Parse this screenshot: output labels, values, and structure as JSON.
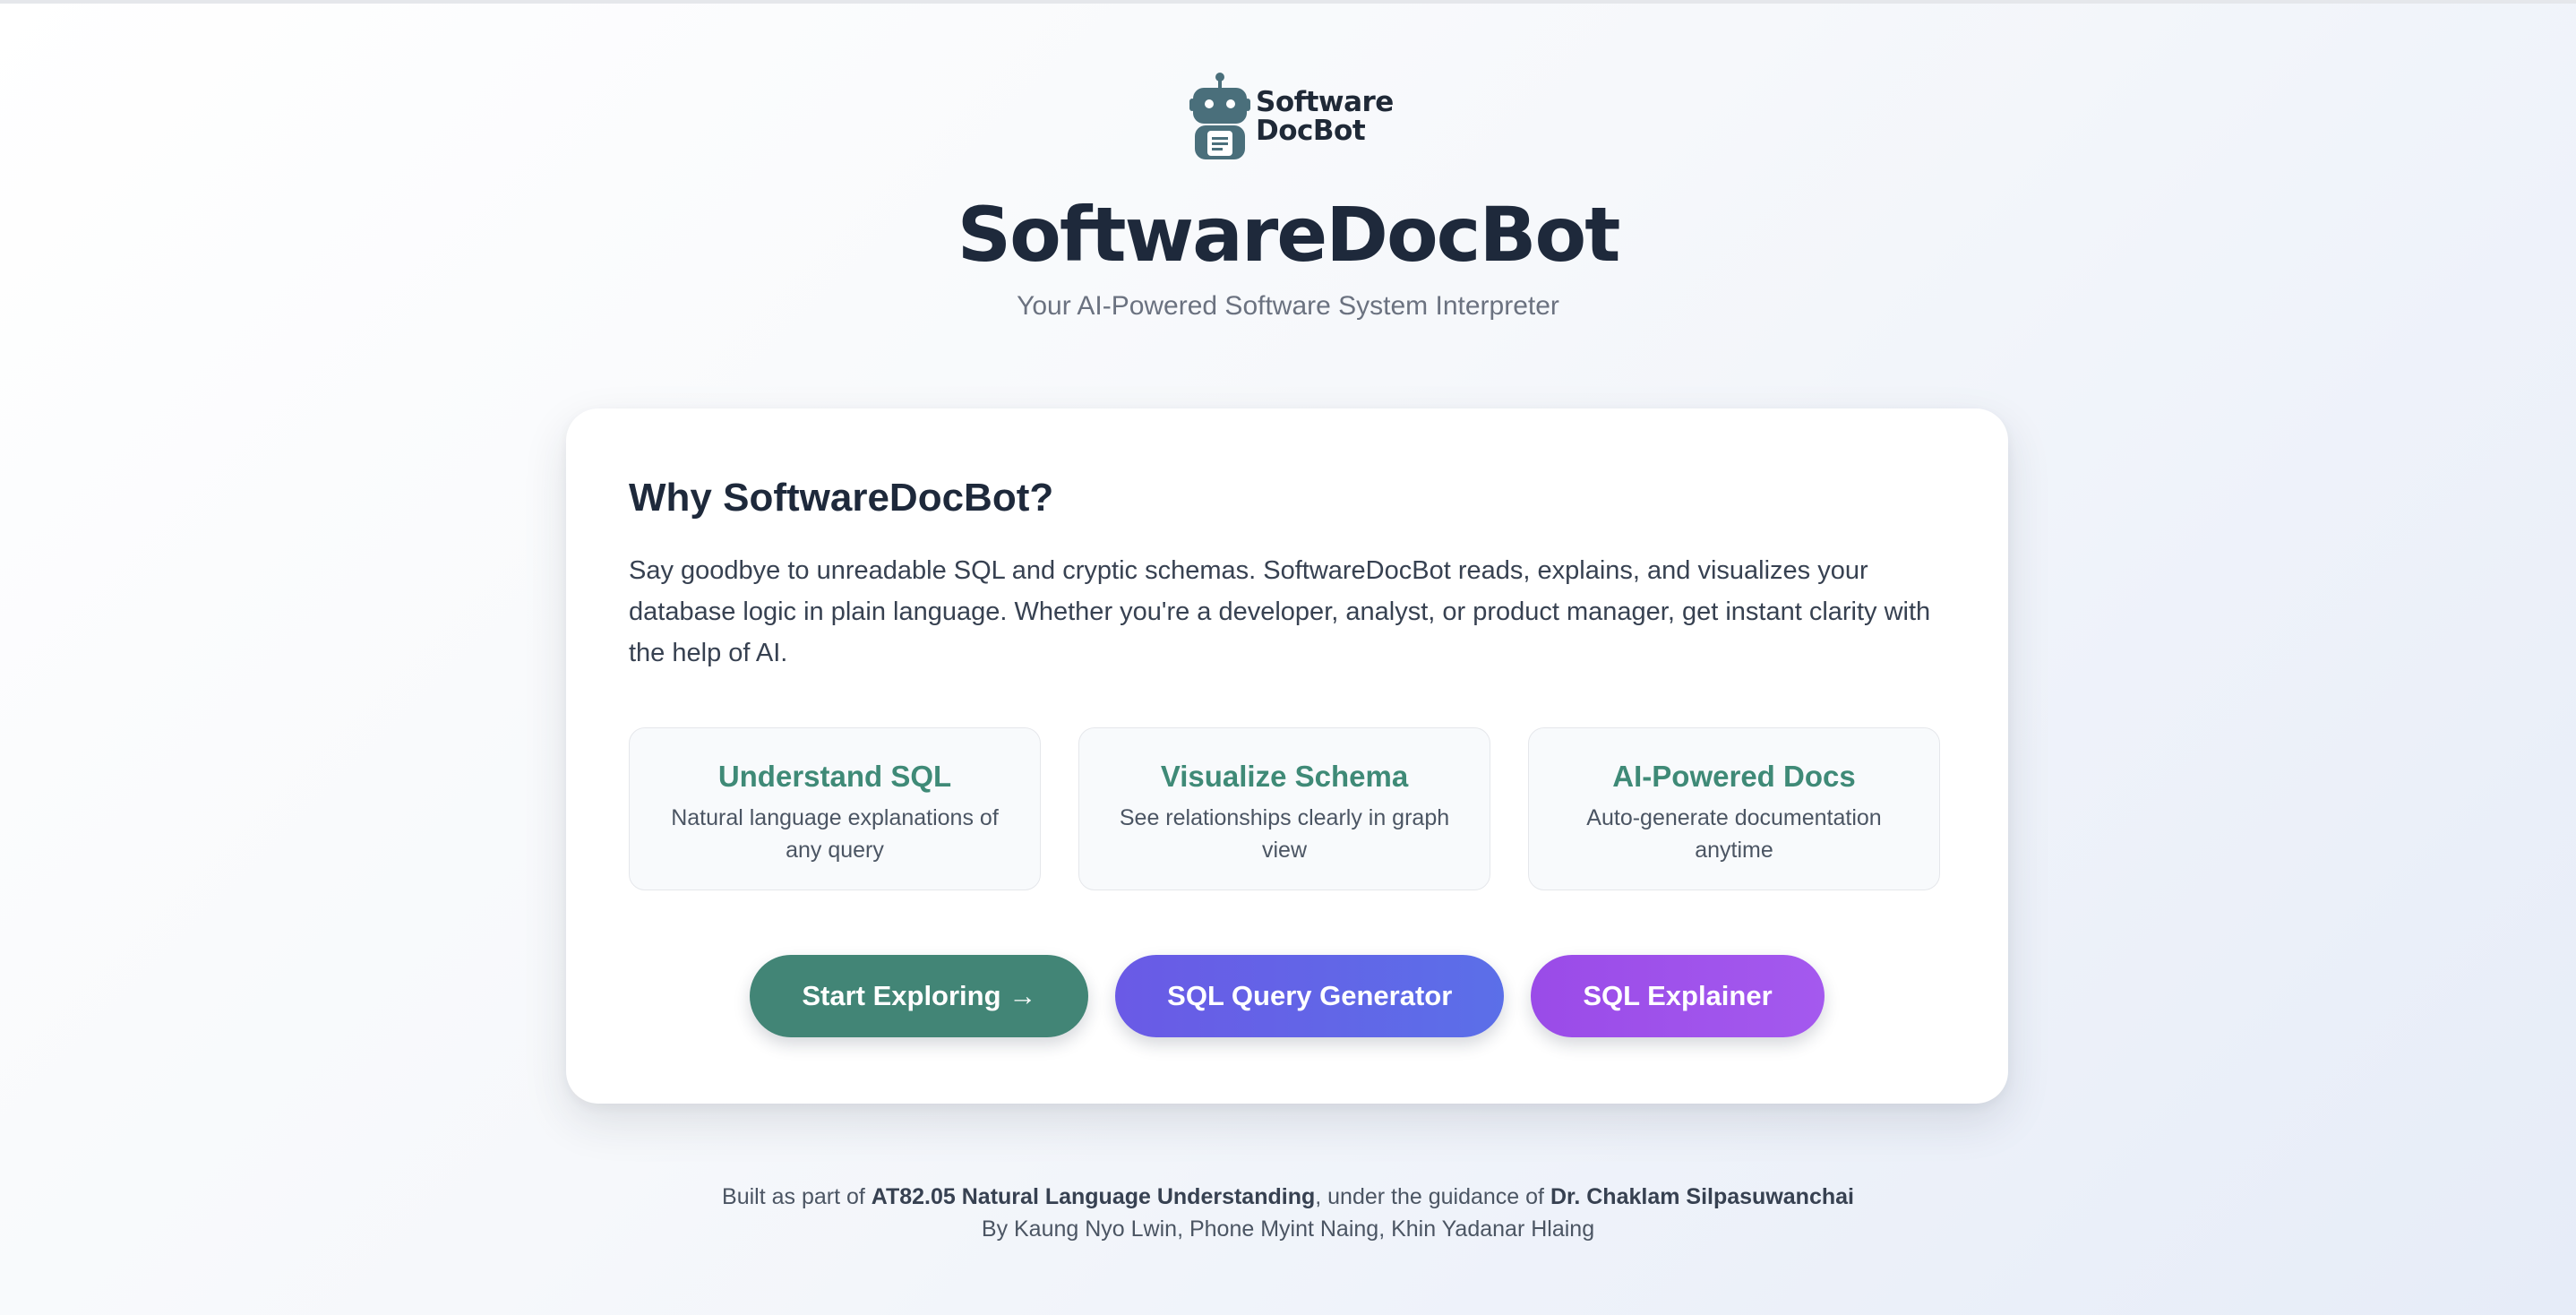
{
  "logo": {
    "line1": "Software",
    "line2": "DocBot"
  },
  "hero": {
    "title": "SoftwareDocBot",
    "subtitle": "Your AI-Powered Software System Interpreter"
  },
  "card": {
    "heading": "Why SoftwareDocBot?",
    "intro": "Say goodbye to unreadable SQL and cryptic schemas. SoftwareDocBot reads, explains, and visualizes your database logic in plain language. Whether you're a developer, analyst, or product manager, get instant clarity with the help of AI.",
    "features": [
      {
        "title": "Understand SQL",
        "desc": "Natural language explanations of any query"
      },
      {
        "title": "Visualize Schema",
        "desc": "See relationships clearly in graph view"
      },
      {
        "title": "AI-Powered Docs",
        "desc": "Auto-generate documentation anytime"
      }
    ],
    "buttons": {
      "start": "Start Exploring →",
      "generator": "SQL Query Generator",
      "explainer": "SQL Explainer"
    }
  },
  "footer": {
    "prefix": "Built as part of ",
    "course": "AT82.05 Natural Language Understanding",
    "middle": ", under the guidance of ",
    "advisor": "Dr. Chaklam Silpasuwanchai",
    "authors": "By Kaung Nyo Lwin, Phone Myint Naing, Khin Yadanar Hlaing"
  },
  "colors": {
    "accent_teal": "#428576",
    "accent_indigo": "#6366f1",
    "accent_purple": "#a459ee"
  }
}
